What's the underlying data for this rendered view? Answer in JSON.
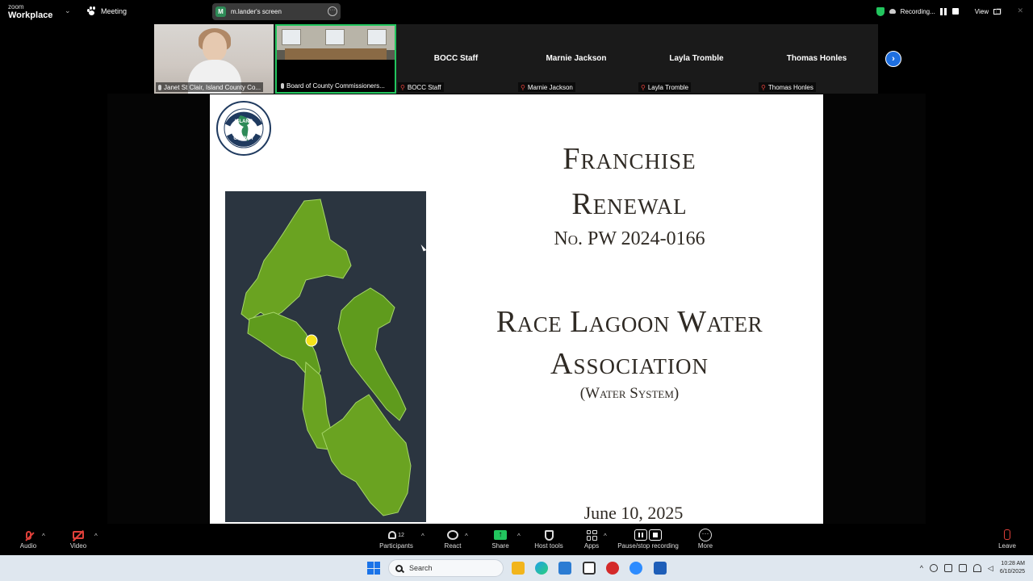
{
  "topbar": {
    "brand_line1": "zoom",
    "brand_line2": "Workplace",
    "meeting_label": "Meeting",
    "screen_badge": "M",
    "screen_label": "m.lander's screen",
    "recording_label": "Recording...",
    "view_label": "View"
  },
  "gallery": {
    "tiles": [
      {
        "label": "Janet St Clair, Island County Co..."
      },
      {
        "label": "Board of County Commissioners..."
      },
      {
        "center_name": "BOCC Staff",
        "label": "BOCC Staff"
      },
      {
        "center_name": "Marnie Jackson",
        "label": "Marnie Jackson"
      },
      {
        "center_name": "Layla Tromble",
        "label": "Layla Tromble"
      },
      {
        "center_name": "Thomas Honles",
        "label": "Thomas Honles"
      }
    ]
  },
  "slide": {
    "logo_top": "ISLAND",
    "logo_bottom": "COUNTY",
    "title_line1": "Franchise",
    "title_line2": "Renewal",
    "number": "No. PW 2024-0166",
    "org_line1": "Race Lagoon Water",
    "org_line2": "Association",
    "subtitle": "(Water System)",
    "date": "June 10, 2025"
  },
  "toolbar": {
    "audio": "Audio",
    "video": "Video",
    "participants": "Participants",
    "participant_count": "12",
    "react": "React",
    "share": "Share",
    "host_tools": "Host tools",
    "apps": "Apps",
    "pause_stop": "Pause/stop recording",
    "more": "More",
    "leave": "Leave"
  },
  "taskbar": {
    "search_placeholder": "Search",
    "time": "10:28 AM",
    "date": "6/10/2025"
  },
  "colors": {
    "accent_green": "#22c55e",
    "muted_red": "#e0403a",
    "next_blue": "#1e6fe0",
    "map_green": "#6aa321"
  }
}
